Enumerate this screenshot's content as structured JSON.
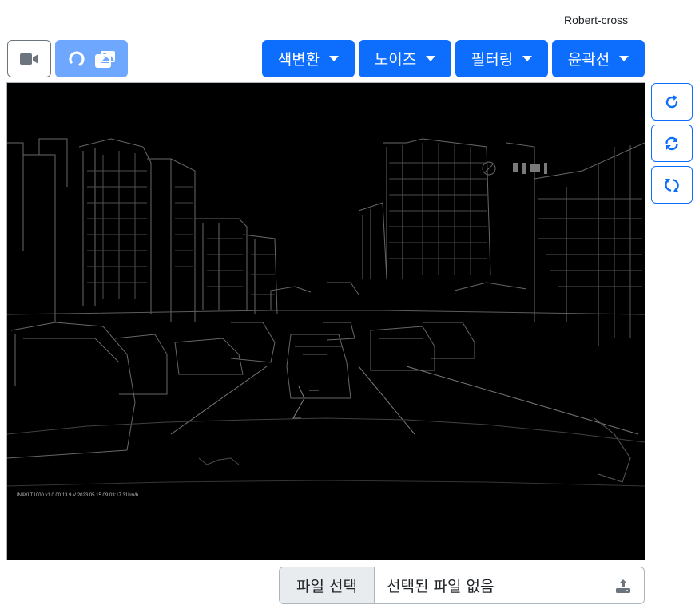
{
  "header": {
    "status_text": "Robert-cross"
  },
  "toolbar": {
    "camera_icon": "video-camera-icon",
    "undo_icon": "undo-icon",
    "gallery_icon": "images-icon",
    "menus": [
      {
        "label": "색변환",
        "icon": "caret-down-icon"
      },
      {
        "label": "노이즈",
        "icon": "caret-down-icon"
      },
      {
        "label": "필터링",
        "icon": "caret-down-icon"
      },
      {
        "label": "윤곽선",
        "icon": "caret-down-icon"
      }
    ],
    "accent_color": "#0d6efd",
    "accent_light_color": "#6ea8fe"
  },
  "side_buttons": [
    {
      "icon": "rotate-cw-icon"
    },
    {
      "icon": "sync-icon"
    },
    {
      "icon": "rotate-both-icon"
    }
  ],
  "canvas": {
    "overlay_text": "INAVI T1000  v1.0.00  13.9 V          2023.05.15 09:03:17   31km/h",
    "sign_text": "이니 비"
  },
  "file_input": {
    "choose_label": "파일 선택",
    "no_file_label": "선택된 파일 없음",
    "upload_icon": "upload-icon"
  }
}
